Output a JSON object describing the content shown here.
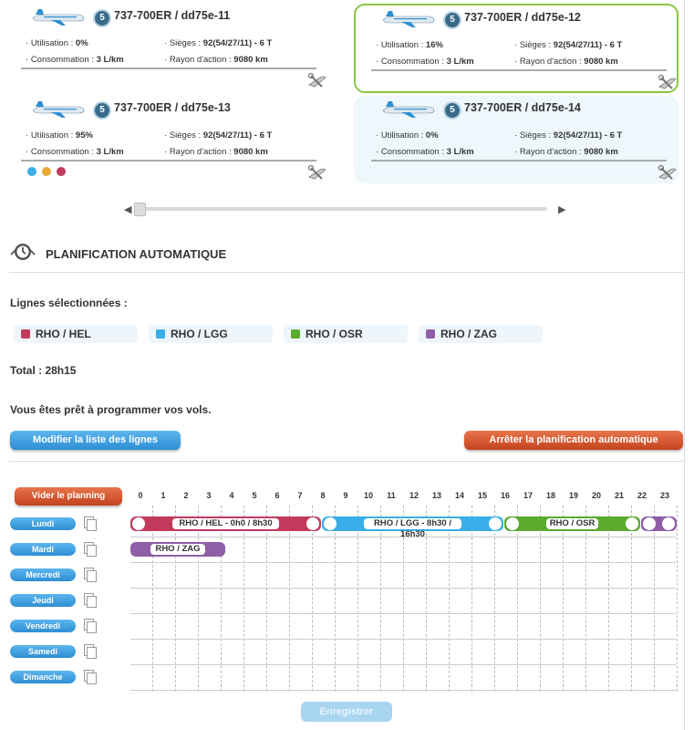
{
  "aircraft": [
    {
      "title": "737-700ER / dd75e-11",
      "badge": "5",
      "util_label": "Utilisation :",
      "util": "0%",
      "seats_label": "Sièges :",
      "seats": "92(54/27/11) - 6 T",
      "cons_label": "Consommation :",
      "cons": "3 L/km",
      "range_label": "Rayon d'action :",
      "range": "9080 km",
      "state": "normal"
    },
    {
      "title": "737-700ER / dd75e-12",
      "badge": "5",
      "util_label": "Utilisation :",
      "util": "16%",
      "seats_label": "Sièges :",
      "seats": "92(54/27/11) - 6 T",
      "cons_label": "Consommation :",
      "cons": "3 L/km",
      "range_label": "Rayon d'action :",
      "range": "9080 km",
      "state": "selected"
    },
    {
      "title": "737-700ER / dd75e-13",
      "badge": "5",
      "util_label": "Utilisation :",
      "util": "95%",
      "seats_label": "Sièges :",
      "seats": "92(54/27/11) - 6 T",
      "cons_label": "Consommation :",
      "cons": "3 L/km",
      "range_label": "Rayon d'action :",
      "range": "9080 km",
      "state": "normal",
      "status_dots": [
        "#3aaee8",
        "#e8a838",
        "#c23a5e"
      ]
    },
    {
      "title": "737-700ER / dd75e-14",
      "badge": "5",
      "util_label": "Utilisation :",
      "util": "0%",
      "seats_label": "Sièges :",
      "seats": "92(54/27/11) - 6 T",
      "cons_label": "Consommation :",
      "cons": "3 L/km",
      "range_label": "Rayon d'action :",
      "range": "9080 km",
      "state": "highlighted"
    }
  ],
  "section": {
    "title": "PLANIFICATION AUTOMATIQUE",
    "icon": "clock-icon"
  },
  "lines_label": "Lignes sélectionnées :",
  "lines": [
    {
      "name": "RHO / HEL",
      "color": "#c23a5e"
    },
    {
      "name": "RHO / LGG",
      "color": "#3aaee8"
    },
    {
      "name": "RHO / OSR",
      "color": "#5aab2e"
    },
    {
      "name": "RHO / ZAG",
      "color": "#8e5ea8"
    }
  ],
  "total": "Total : 28h15",
  "ready_msg": "Vous êtes prêt à programmer vos vols.",
  "buttons": {
    "modify": "Modifier la liste des lignes",
    "stop": "Arrêter la planification automatique",
    "clear": "Vider le planning",
    "save": "Enregistrer"
  },
  "hours": [
    "0",
    "1",
    "2",
    "3",
    "4",
    "5",
    "6",
    "7",
    "8",
    "9",
    "10",
    "11",
    "12",
    "13",
    "14",
    "15",
    "16",
    "17",
    "18",
    "19",
    "20",
    "21",
    "22",
    "23"
  ],
  "days": [
    "Lundi",
    "Mardi",
    "Mercredi",
    "Jeudi",
    "Vendredi",
    "Samedi",
    "Dimanche"
  ],
  "schedule": [
    {
      "day": 0,
      "start": 0,
      "end": 8.4,
      "color": "#c23a5e",
      "label": "RHO / HEL - 0h0 / 8h30"
    },
    {
      "day": 0,
      "start": 8.4,
      "end": 16.4,
      "color": "#3aaee8",
      "label": "RHO / LGG - 8h30 / 16h30"
    },
    {
      "day": 0,
      "start": 16.4,
      "end": 22.4,
      "color": "#5aab2e",
      "label": "RHO / OSR"
    },
    {
      "day": 0,
      "start": 22.4,
      "end": 24,
      "color": "#8e5ea8",
      "label": ""
    },
    {
      "day": 1,
      "start": 0,
      "end": 4.2,
      "color": "#8e5ea8",
      "label": "RHO / ZAG"
    }
  ],
  "colors": {
    "accent_blue": "#2e8fd4",
    "accent_orange": "#c2441f",
    "selected_border": "#8cc63f"
  }
}
